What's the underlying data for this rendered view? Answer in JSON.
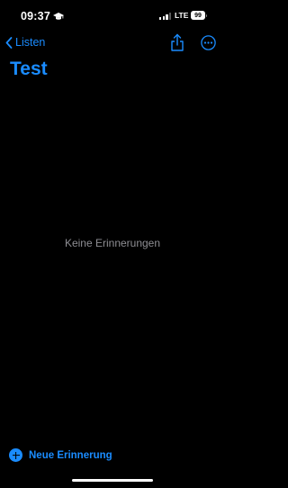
{
  "status_bar": {
    "time": "09:37",
    "network": "LTE",
    "battery": "99",
    "icons": [
      "graduation-cap-icon",
      "signal-icon",
      "battery-icon"
    ]
  },
  "nav": {
    "back_label": "Listen",
    "icons": [
      "chevron-left-icon",
      "share-icon",
      "more-icon"
    ]
  },
  "list": {
    "title": "Test",
    "empty_message": "Keine Erinnerungen"
  },
  "toolbar": {
    "new_reminder_label": "Neue Erinnerung",
    "icon": "plus-circle-icon"
  },
  "colors": {
    "accent": "#1a8cff",
    "background": "#000000",
    "secondary_text": "#8e8e93"
  }
}
